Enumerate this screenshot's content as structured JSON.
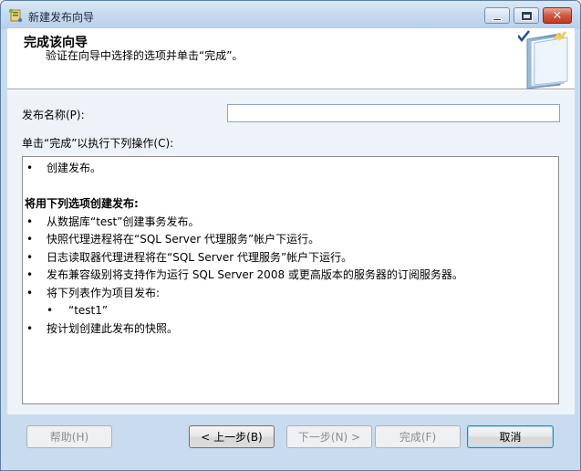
{
  "window": {
    "title": "新建发布向导",
    "controls": {
      "minimize_icon": "minimize-icon",
      "maximize_icon": "maximize-icon",
      "close_icon": "close-icon",
      "close_glyph": "✕"
    }
  },
  "header": {
    "title": "完成该向导",
    "subtitle": "验证在向导中选择的选项并单击“完成”。",
    "graphic_icon": "wizard-book-checkmark-icon"
  },
  "form": {
    "publication_name_label": "发布名称(P):",
    "publication_name_value": "",
    "actions_label": "单击“完成”以执行下列操作(C):"
  },
  "actions": {
    "bullet": "•",
    "create": "创建发布。",
    "options_heading": "将用下列选项创建发布:",
    "items": [
      "从数据库“test”创建事务发布。",
      "快照代理进程将在“SQL Server 代理服务”帐户下运行。",
      "日志读取器代理进程将在“SQL Server 代理服务”帐户下运行。",
      "发布兼容级别将支持作为运行 SQL Server 2008 或更高版本的服务器的订阅服务器。",
      "将下列表作为项目发布:"
    ],
    "sub_items": [
      "“test1”"
    ],
    "last_item": "按计划创建此发布的快照。"
  },
  "footer": {
    "help": "帮助(H)",
    "back": "< 上一步(B)",
    "next": "下一步(N) >",
    "finish": "完成(F)",
    "cancel": "取消"
  },
  "colors": {
    "frame": "#c9dbee",
    "close_button": "#c23a22",
    "body_background": "#eef3f9"
  }
}
